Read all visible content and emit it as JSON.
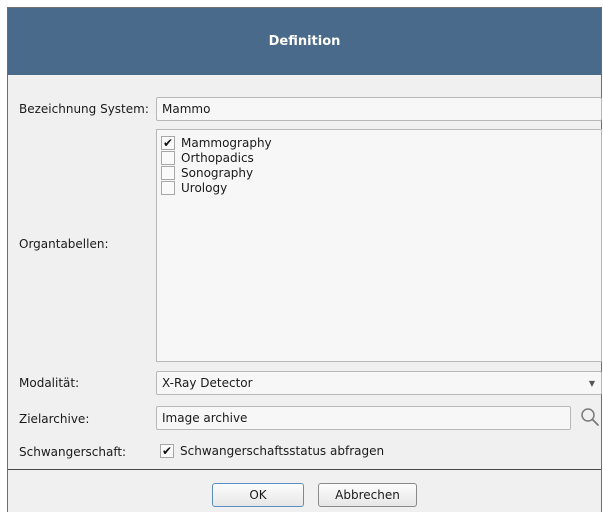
{
  "dialog": {
    "title": "Definition"
  },
  "form": {
    "system_name": {
      "label": "Bezeichnung System:",
      "value": "Mammo"
    },
    "organ_tables": {
      "label": "Organtabellen:",
      "items": [
        {
          "label": "Mammography",
          "checked": true,
          "mark": "✔"
        },
        {
          "label": "Orthopadics",
          "checked": false,
          "mark": ""
        },
        {
          "label": "Sonography",
          "checked": false,
          "mark": ""
        },
        {
          "label": "Urology",
          "checked": false,
          "mark": ""
        }
      ]
    },
    "modality": {
      "label": "Modalität:",
      "value": "X-Ray Detector"
    },
    "target_archive": {
      "label": "Zielarchive:",
      "value": "Image archive"
    },
    "pregnancy": {
      "label": "Schwangerschaft:",
      "checkbox_label": "Schwangerschaftsstatus abfragen",
      "checked": true,
      "mark": "✔"
    }
  },
  "buttons": {
    "ok": "OK",
    "cancel": "Abbrechen"
  },
  "icons": {
    "dropdown": "chevron-down-icon",
    "search": "search-icon"
  },
  "colors": {
    "titlebar": "#4a6a8c",
    "ok_border": "#5d8fc7"
  }
}
